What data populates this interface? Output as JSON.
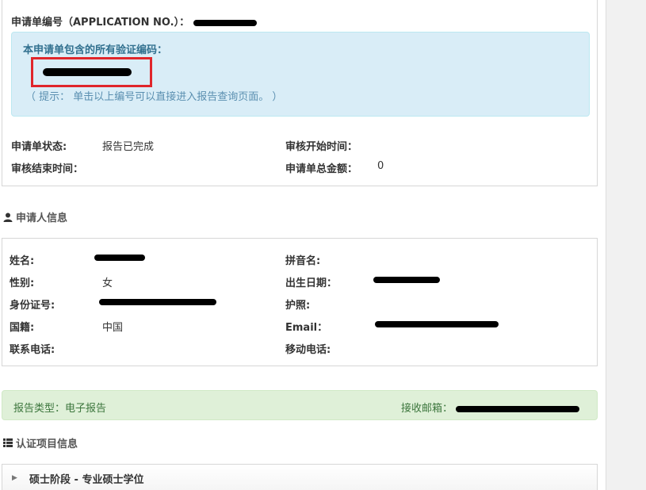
{
  "application": {
    "number_label": "申请单编号（APPLICATION NO.）：",
    "codes_title": "本申请单包含的所有验证编码：",
    "hint": "（ 提示： 单击以上编号可以直接进入报告查询页面。 ）",
    "status_label": "申请单状态:",
    "status_value": "报告已完成",
    "review_start_label": "审核开始时间：",
    "review_end_label": "审核结束时间：",
    "total_label": "申请单总金额：",
    "total_value": "0"
  },
  "applicant_section": {
    "title": "申请人信息",
    "icon": "user-icon"
  },
  "applicant": {
    "name_label": "姓名:",
    "pinyin_label": "拼音名:",
    "gender_label": "性别:",
    "gender_value": "女",
    "dob_label": "出生日期：",
    "id_label": "身份证号:",
    "passport_label": "护照:",
    "nationality_label": "国籍:",
    "nationality_value": "中国",
    "email_label": "Email：",
    "phone_label": "联系电话:",
    "mobile_label": "移动电话:"
  },
  "report": {
    "type_label": "报告类型：电子报告",
    "email_label": "接收邮箱："
  },
  "cert_section": {
    "title": "认证项目信息",
    "icon": "list-icon"
  },
  "accordion": {
    "label": "硕士阶段 - 专业硕士学位"
  },
  "colors": {
    "info_bg": "#d9edf7",
    "info_text": "#31708f",
    "success_bg": "#dff0d8",
    "success_text": "#3c763d",
    "highlight": "#e0262b"
  }
}
